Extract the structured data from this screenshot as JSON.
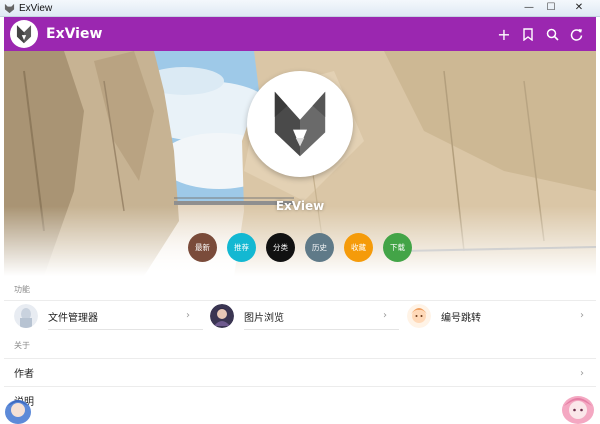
{
  "window": {
    "title": "ExView",
    "minimize_glyph": "—",
    "maximize_glyph": "☐",
    "close_glyph": "✕"
  },
  "appbar": {
    "title": "ExView",
    "background": "#9b27b0",
    "actions": [
      {
        "icon": "add-icon",
        "glyph": "+"
      },
      {
        "icon": "bookmark-icon"
      },
      {
        "icon": "search-icon"
      },
      {
        "icon": "refresh-icon"
      }
    ]
  },
  "hero": {
    "name": "ExView",
    "chips": [
      {
        "label": "最新",
        "color": "#7a4b3a"
      },
      {
        "label": "推荐",
        "color": "#13b8d2"
      },
      {
        "label": "分类",
        "color": "#111111"
      },
      {
        "label": "历史",
        "color": "#5f7a88"
      },
      {
        "label": "收藏",
        "color": "#f59b0a"
      },
      {
        "label": "下载",
        "color": "#43a447"
      }
    ]
  },
  "sections": {
    "features_title": "功能",
    "about_title": "关于"
  },
  "features": [
    {
      "label": "文件管理器",
      "chevron": "›"
    },
    {
      "label": "图片浏览",
      "chevron": "›"
    },
    {
      "label": "编号跳转",
      "chevron": "›"
    }
  ],
  "about": [
    {
      "label": "作者",
      "chevron": "›"
    },
    {
      "label": "说明"
    }
  ]
}
